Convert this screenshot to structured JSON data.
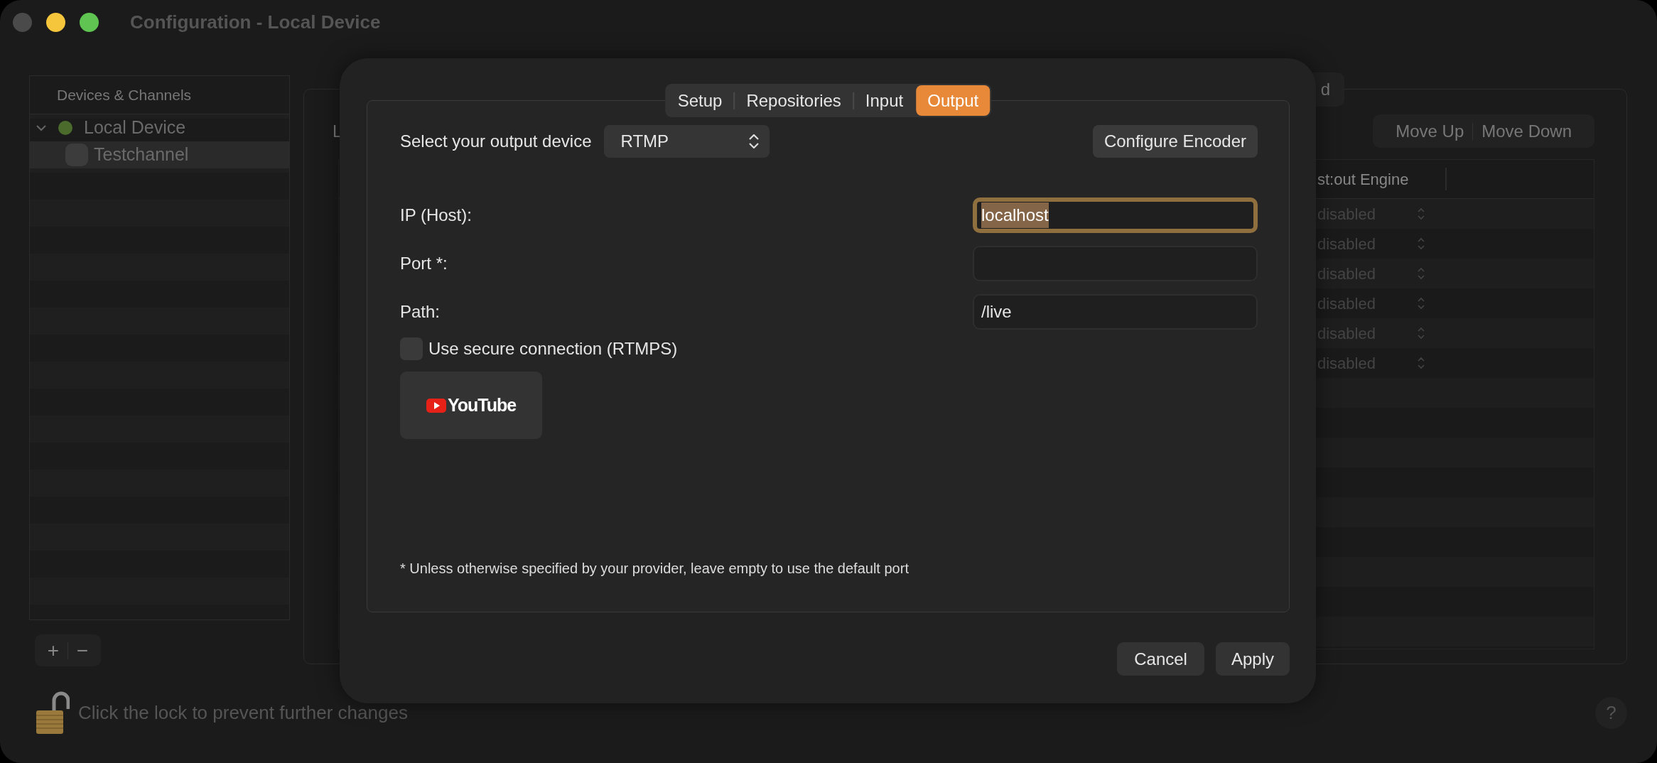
{
  "window": {
    "title": "Configuration - Local Device",
    "controls": [
      {
        "kind": "close"
      },
      {
        "kind": "minimize"
      },
      {
        "kind": "zoom"
      }
    ]
  },
  "sidebar": {
    "header": "Devices & Channels",
    "items": [
      {
        "label": "Local Device",
        "expanded": true,
        "selected": false,
        "children": [
          {
            "label": "Testchannel",
            "selected": true
          }
        ]
      }
    ],
    "buttons": [
      "+",
      "−"
    ]
  },
  "main": {
    "label": "L",
    "segment_fragment": "d",
    "buttons": [
      "Move Up",
      "Move Down"
    ],
    "table": {
      "columns": [
        "st:out Engine"
      ],
      "rows": [
        {
          "cells": [
            "disabled"
          ]
        },
        {
          "cells": [
            "disabled"
          ]
        },
        {
          "cells": [
            "disabled"
          ]
        },
        {
          "cells": [
            "disabled"
          ]
        },
        {
          "cells": [
            "disabled"
          ]
        },
        {
          "cells": [
            "disabled"
          ]
        }
      ]
    }
  },
  "dialog": {
    "tabs": [
      {
        "label": "Setup",
        "selected": false
      },
      {
        "label": "Repositories",
        "selected": false
      },
      {
        "label": "Input",
        "selected": false
      },
      {
        "label": "Output",
        "selected": true
      }
    ],
    "output_device": {
      "label": "Select your output device",
      "value": "RTMP"
    },
    "configure_button": "Configure Encoder",
    "fields": [
      {
        "label": "IP (Host):",
        "value": "localhost",
        "focused": true
      },
      {
        "label": "Port *:",
        "focused": false
      },
      {
        "label": "Path:",
        "value": "/live",
        "focused": false
      }
    ],
    "checkbox": {
      "label": "Use secure connection (RTMPS)",
      "checked": false
    },
    "youtube_button": {
      "label": "YouTube"
    },
    "footnote": "* Unless otherwise specified by your provider, leave empty to use the default port",
    "buttons": [
      "Cancel",
      "Apply"
    ]
  },
  "lock": {
    "locked": false,
    "text": "Click the lock to prevent further changes"
  },
  "help": "?"
}
